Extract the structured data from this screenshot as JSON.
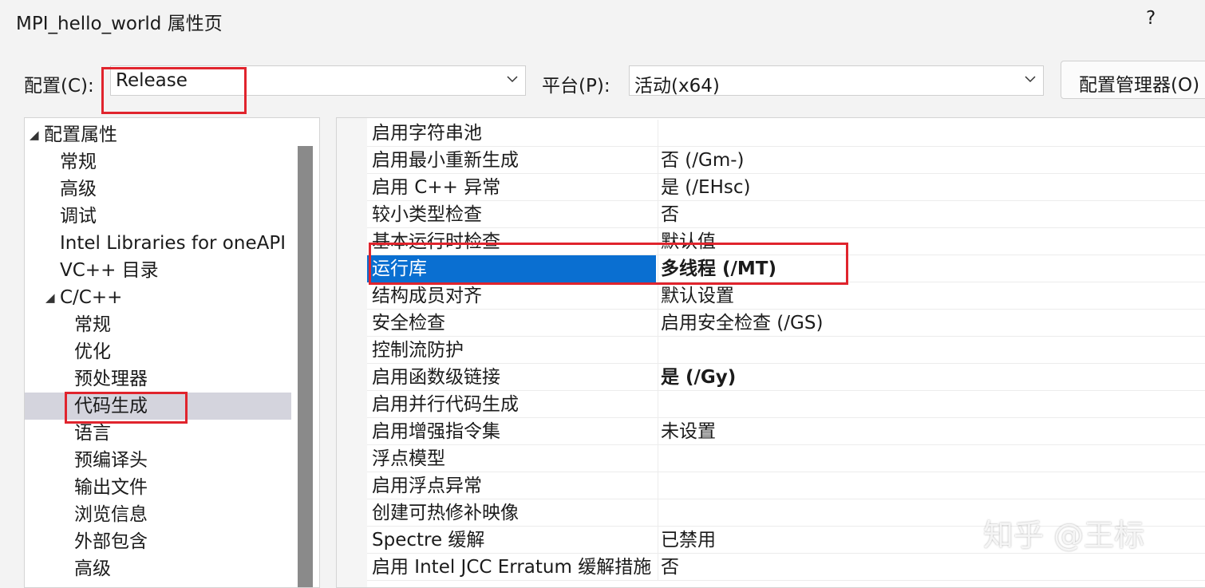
{
  "window": {
    "title": "MPI_hello_world 属性页",
    "help": "?"
  },
  "toolbar": {
    "config_label": "配置(C):",
    "config_value": "Release",
    "platform_label": "平台(P):",
    "platform_value": "活动(x64)",
    "config_manager_label": "配置管理器(O)"
  },
  "tree": {
    "items": [
      {
        "label": "配置属性",
        "level": 0,
        "expanded": true
      },
      {
        "label": "常规",
        "level": 1
      },
      {
        "label": "高级",
        "level": 1
      },
      {
        "label": "调试",
        "level": 1
      },
      {
        "label": "Intel Libraries for oneAPI",
        "level": 1
      },
      {
        "label": "VC++ 目录",
        "level": 1
      },
      {
        "label": "C/C++",
        "level": 1,
        "expanded": true
      },
      {
        "label": "常规",
        "level": 2
      },
      {
        "label": "优化",
        "level": 2
      },
      {
        "label": "预处理器",
        "level": 2
      },
      {
        "label": "代码生成",
        "level": 2,
        "selected": true
      },
      {
        "label": "语言",
        "level": 2
      },
      {
        "label": "预编译头",
        "level": 2
      },
      {
        "label": "输出文件",
        "level": 2
      },
      {
        "label": "浏览信息",
        "level": 2
      },
      {
        "label": "外部包含",
        "level": 2
      },
      {
        "label": "高级",
        "level": 2
      }
    ]
  },
  "properties": [
    {
      "name": "启用字符串池",
      "value": ""
    },
    {
      "name": "启用最小重新生成",
      "value": "否 (/Gm-)"
    },
    {
      "name": "启用 C++ 异常",
      "value": "是 (/EHsc)"
    },
    {
      "name": "较小类型检查",
      "value": "否"
    },
    {
      "name": "基本运行时检查",
      "value": "默认值"
    },
    {
      "name": "运行库",
      "value": "多线程 (/MT)",
      "bold": true,
      "selected": true
    },
    {
      "name": "结构成员对齐",
      "value": "默认设置"
    },
    {
      "name": "安全检查",
      "value": "启用安全检查 (/GS)"
    },
    {
      "name": "控制流防护",
      "value": ""
    },
    {
      "name": "启用函数级链接",
      "value": "是 (/Gy)",
      "bold": true
    },
    {
      "name": "启用并行代码生成",
      "value": ""
    },
    {
      "name": "启用增强指令集",
      "value": "未设置"
    },
    {
      "name": "浮点模型",
      "value": ""
    },
    {
      "name": "启用浮点异常",
      "value": ""
    },
    {
      "name": "创建可热修补映像",
      "value": ""
    },
    {
      "name": "Spectre 缓解",
      "value": "已禁用"
    },
    {
      "name": "启用 Intel JCC Erratum 缓解措施",
      "value": "否"
    }
  ],
  "watermark": "知乎 @王标",
  "colors": {
    "selection": "#0a6fd1",
    "tree_selection": "#d4d4dd",
    "annotation": "#e0242d"
  }
}
